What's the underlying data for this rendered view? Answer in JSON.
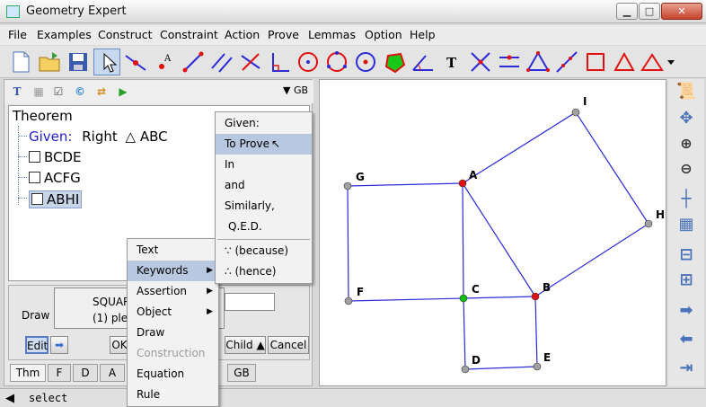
{
  "window": {
    "title": "Geometry Expert"
  },
  "menubar": [
    "File",
    "Examples",
    "Construct",
    "Constraint",
    "Action",
    "Prove",
    "Lemmas",
    "Option",
    "Help"
  ],
  "mini_toolbar": {
    "language": "GB"
  },
  "theorem_tree": {
    "root": "Theorem",
    "given_label": "Given:",
    "given_text": "Right",
    "triangle_symbol": "△",
    "given_triangle": "ABC",
    "items": [
      "BCDE",
      "ACFG",
      "ABHI"
    ]
  },
  "draw_panel": {
    "label": "Draw",
    "line1": "SQUAR",
    "line2": "(1) plea",
    "edit": "Edit",
    "ok": "OK",
    "child": "Child",
    "cancel": "Cancel"
  },
  "tabs": [
    "Thm",
    "F",
    "D",
    "A",
    "GB"
  ],
  "status": {
    "text": "select"
  },
  "context_menu": {
    "items": [
      {
        "label": "Text",
        "submenu": false,
        "enabled": true
      },
      {
        "label": "Keywords",
        "submenu": true,
        "enabled": true,
        "highlighted": true
      },
      {
        "label": "Assertion",
        "submenu": true,
        "enabled": true
      },
      {
        "label": "Object",
        "submenu": true,
        "enabled": true
      },
      {
        "label": "Draw",
        "submenu": false,
        "enabled": true
      },
      {
        "label": "Construction",
        "submenu": false,
        "enabled": false
      },
      {
        "label": "Equation",
        "submenu": false,
        "enabled": true
      },
      {
        "label": "Rule",
        "submenu": false,
        "enabled": true
      }
    ]
  },
  "keywords_submenu": {
    "items": [
      "Given:",
      "To Prove",
      "In",
      "and",
      "Similarly,",
      "Q.E.D."
    ],
    "symbols": [
      "(because)",
      "(hence)"
    ],
    "highlighted": "To Prove"
  },
  "points": [
    "A",
    "B",
    "C",
    "D",
    "E",
    "F",
    "G",
    "H",
    "I"
  ],
  "colors": {
    "line": "#2b2bd8",
    "point_red": "#e01010",
    "point_green": "#10c010",
    "point_gray": "#a0a0a0",
    "accent": "#4a72b8"
  }
}
